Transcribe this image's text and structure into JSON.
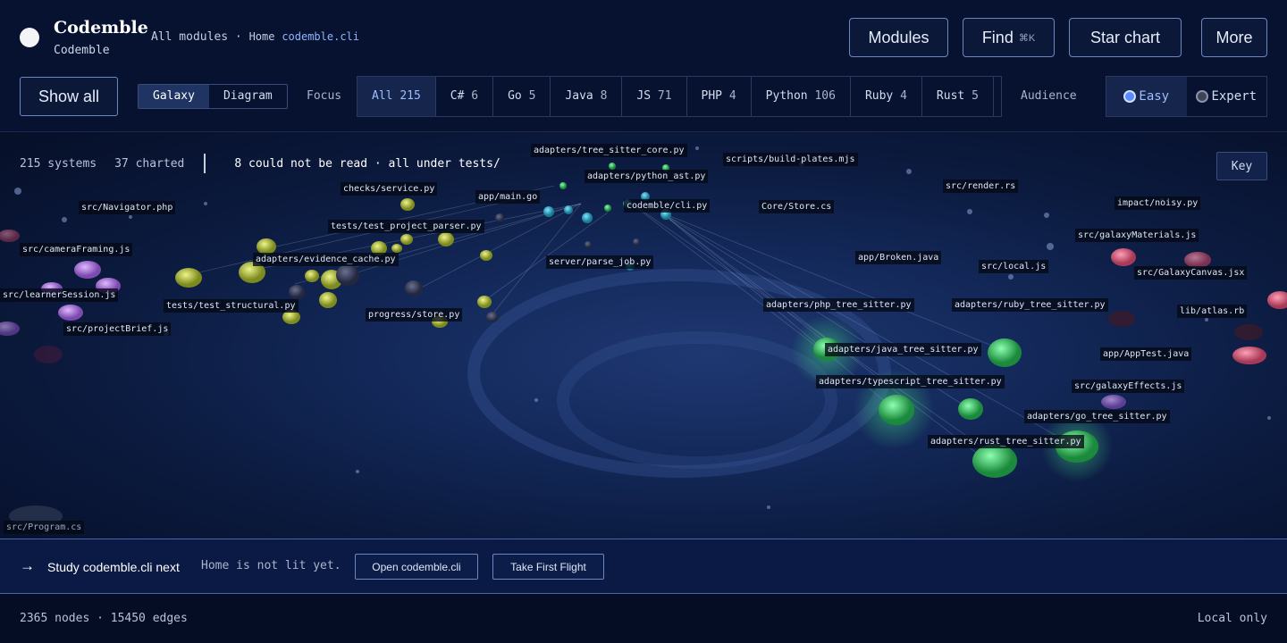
{
  "app": {
    "title": "Codemble",
    "subtitle": "Codemble"
  },
  "breadcrumb": {
    "root": "All modules",
    "separator": "·",
    "home": "Home",
    "current": "codemble.cli"
  },
  "top_buttons": {
    "modules": "Modules",
    "find": "Find",
    "find_shortcut": "⌘K",
    "star_chart": "Star chart",
    "more": "More"
  },
  "toolbar": {
    "show_all": "Show all",
    "views": [
      "Galaxy",
      "Diagram"
    ],
    "active_view": "Galaxy",
    "focus_label": "Focus",
    "languages": [
      {
        "name": "All",
        "count": "215",
        "active": true
      },
      {
        "name": "C#",
        "count": "6"
      },
      {
        "name": "Go",
        "count": "5"
      },
      {
        "name": "Java",
        "count": "8"
      },
      {
        "name": "JS",
        "count": "71"
      },
      {
        "name": "PHP",
        "count": "4"
      },
      {
        "name": "Python",
        "count": "106"
      },
      {
        "name": "Ruby",
        "count": "4"
      },
      {
        "name": "Rust",
        "count": "5"
      }
    ],
    "audience_label": "Audience",
    "audience": {
      "easy": "Easy",
      "expert": "Expert",
      "selected": "Easy"
    }
  },
  "galaxy": {
    "stats": {
      "systems": "215 systems",
      "charted": "37 charted",
      "warning": "8 could not be read · all under tests/"
    },
    "key_button": "Key",
    "labels": [
      "adapters/tree_sitter_core.py",
      "scripts/build-plates.mjs",
      "adapters/python_ast.py",
      "checks/service.py",
      "app/main.go",
      "src/render.rs",
      "impact/noisy.py",
      "src/Navigator.php",
      "codemble/cli.py",
      "Core/Store.cs",
      "tests/test_project_parser.py",
      "src/galaxyMaterials.js",
      "src/cameraFraming.js",
      "adapters/evidence_cache.py",
      "server/parse_job.py",
      "app/Broken.java",
      "src/local.js",
      "src/GalaxyCanvas.jsx",
      "src/learnerSession.js",
      "tests/test_structural.py",
      "adapters/php_tree_sitter.py",
      "adapters/ruby_tree_sitter.py",
      "lib/atlas.rb",
      "progress/store.py",
      "src/projectBrief.js",
      "adapters/java_tree_sitter.py",
      "app/AppTest.java",
      "adapters/typescript_tree_sitter.py",
      "src/galaxyEffects.js",
      "adapters/go_tree_sitter.py",
      "adapters/rust_tree_sitter.py",
      "src/Program.cs"
    ]
  },
  "next_step": {
    "arrow": "→",
    "title": "Study codemble.cli next",
    "note": "Home is not lit yet.",
    "open_button": "Open codemble.cli",
    "flight_button": "Take First Flight"
  },
  "footer": {
    "counts": "2365 nodes · 15450 edges",
    "mode": "Local only"
  },
  "colors": {
    "background": "#06102a",
    "accent": "#8fb4ff",
    "python_nodes": "#c9d84a",
    "go_nodes": "#3fcf6a",
    "js_nodes": "#b07adf",
    "php_nodes": "#e06a8a"
  }
}
